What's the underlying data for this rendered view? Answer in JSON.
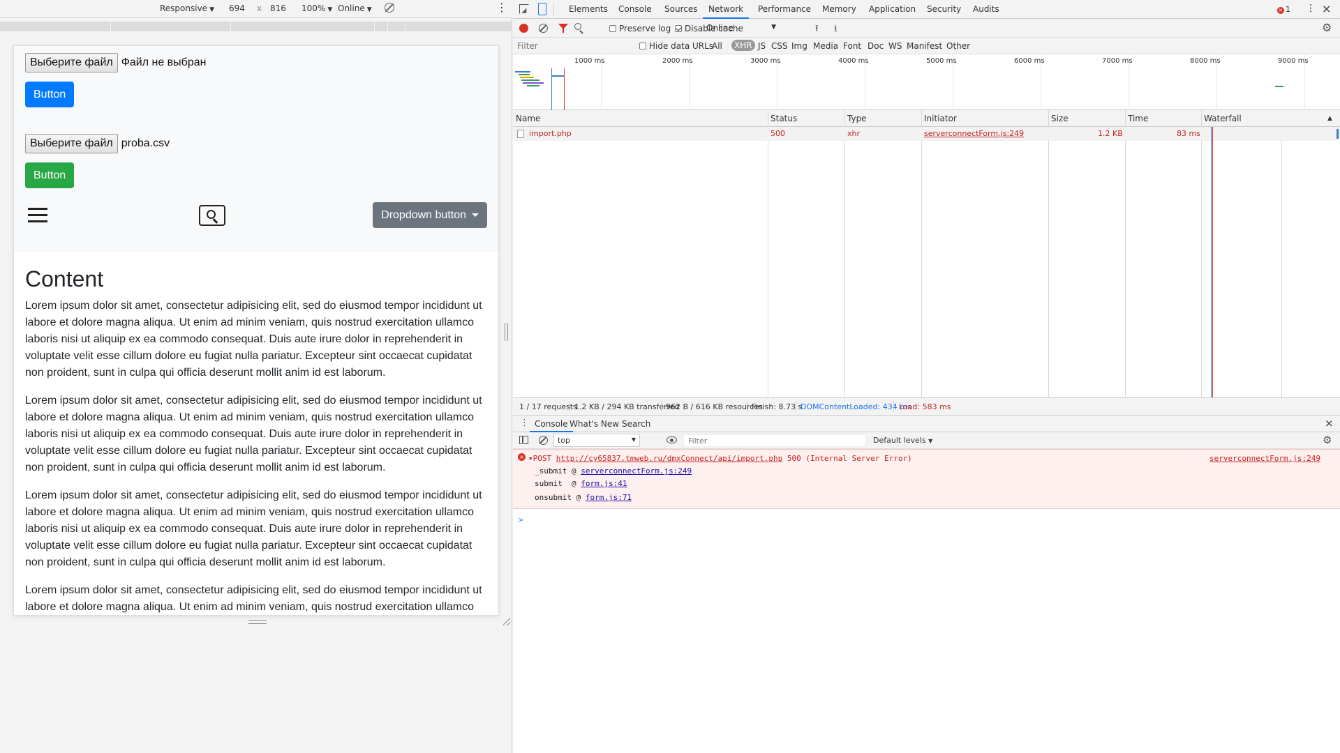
{
  "device_toolbar": {
    "mode": "Responsive",
    "width": "694",
    "x": "x",
    "height": "816",
    "zoom": "100%",
    "network": "Online"
  },
  "page": {
    "file_button_label": "Выберите файл",
    "file1_name": "Файл не выбран",
    "button1_label": "Button",
    "file2_name": "proba.csv",
    "button2_label": "Button",
    "dropdown_label": "Dropdown button",
    "heading": "Content",
    "paragraphs": [
      "Lorem ipsum dolor sit amet, consectetur adipisicing elit, sed do eiusmod tempor incididunt ut labore et dolore magna aliqua. Ut enim ad minim veniam, quis nostrud exercitation ullamco laboris nisi ut aliquip ex ea commodo consequat. Duis aute irure dolor in reprehenderit in voluptate velit esse cillum dolore eu fugiat nulla pariatur. Excepteur sint occaecat cupidatat non proident, sunt in culpa qui officia deserunt mollit anim id est laborum.",
      "Lorem ipsum dolor sit amet, consectetur adipisicing elit, sed do eiusmod tempor incididunt ut labore et dolore magna aliqua. Ut enim ad minim veniam, quis nostrud exercitation ullamco laboris nisi ut aliquip ex ea commodo consequat. Duis aute irure dolor in reprehenderit in voluptate velit esse cillum dolore eu fugiat nulla pariatur. Excepteur sint occaecat cupidatat non proident, sunt in culpa qui officia deserunt mollit anim id est laborum.",
      "Lorem ipsum dolor sit amet, consectetur adipisicing elit, sed do eiusmod tempor incididunt ut labore et dolore magna aliqua. Ut enim ad minim veniam, quis nostrud exercitation ullamco laboris nisi ut aliquip ex ea commodo consequat. Duis aute irure dolor in reprehenderit in voluptate velit esse cillum dolore eu fugiat nulla pariatur. Excepteur sint occaecat cupidatat non proident, sunt in culpa qui officia deserunt mollit anim id est laborum.",
      "Lorem ipsum dolor sit amet, consectetur adipisicing elit, sed do eiusmod tempor incididunt ut labore et dolore magna aliqua. Ut enim ad minim veniam, quis nostrud exercitation ullamco"
    ],
    "colors": {
      "primary": "#007bff",
      "success": "#28a745",
      "secondary": "#6c757d"
    }
  },
  "devtools": {
    "tabs": [
      "Elements",
      "Console",
      "Sources",
      "Network",
      "Performance",
      "Memory",
      "Application",
      "Security",
      "Audits"
    ],
    "active_tab": "Network",
    "error_count": "1",
    "toolbar": {
      "preserve_log": "Preserve log",
      "disable_cache": "Disable cache",
      "throttle": "Online"
    },
    "filter": {
      "placeholder": "Filter",
      "hide_data_urls": "Hide data URLs",
      "types": [
        "All",
        "XHR",
        "JS",
        "CSS",
        "Img",
        "Media",
        "Font",
        "Doc",
        "WS",
        "Manifest",
        "Other"
      ],
      "selected": "XHR"
    },
    "overview_ticks": [
      "1000 ms",
      "2000 ms",
      "3000 ms",
      "4000 ms",
      "5000 ms",
      "6000 ms",
      "7000 ms",
      "8000 ms",
      "9000 ms"
    ],
    "columns": [
      "Name",
      "Status",
      "Type",
      "Initiator",
      "Size",
      "Time",
      "Waterfall"
    ],
    "requests": [
      {
        "name": "import.php",
        "status": "500",
        "type": "xhr",
        "initiator": "serverconnectForm.js:249",
        "size": "1.2 KB",
        "time": "83 ms"
      }
    ],
    "status_bar": {
      "requests": "1 / 17 requests",
      "transferred": "1.2 KB / 294 KB transferred",
      "resources": "962 B / 616 KB resources",
      "finish": "Finish: 8.73 s",
      "dom_content_loaded": "DOMContentLoaded: 434 ms",
      "load": "Load: 583 ms"
    },
    "drawer_tabs": [
      "Console",
      "What's New",
      "Search"
    ],
    "console": {
      "context": "top",
      "filter_placeholder": "Filter",
      "levels": "Default levels",
      "error": {
        "prefix": "POST",
        "url": "http://cy65837.tmweb.ru/dmxConnect/api/import.php",
        "suffix": "500 (Internal Server Error)",
        "source": "serverconnectForm.js:249",
        "stack": [
          {
            "fn": "_submit",
            "at": "@",
            "loc": "serverconnectForm.js:249"
          },
          {
            "fn": "submit",
            "at": "@",
            "loc": "form.js:41"
          },
          {
            "fn": "onsubmit",
            "at": "@",
            "loc": "form.js:71"
          }
        ]
      },
      "prompt": ">"
    }
  }
}
